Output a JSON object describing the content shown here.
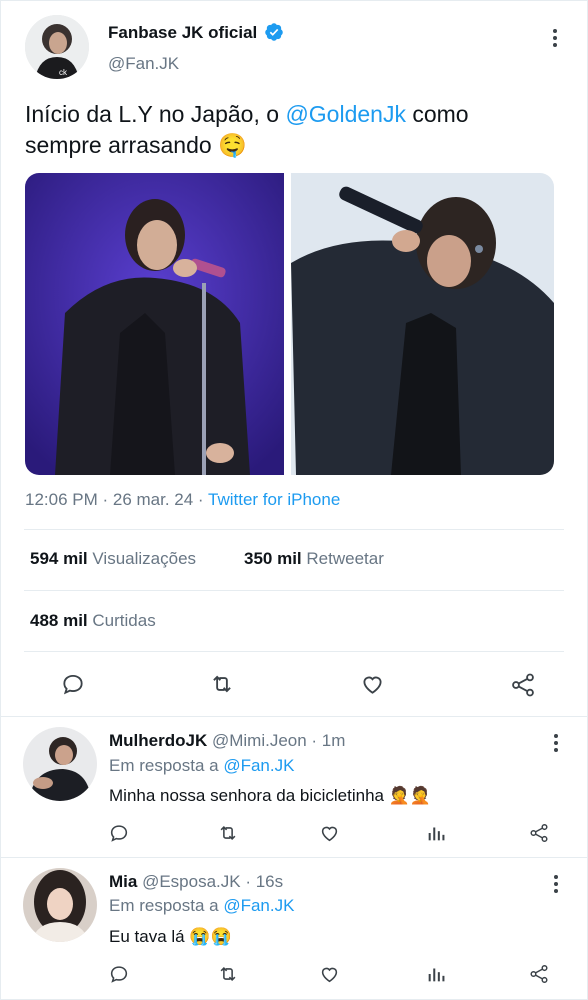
{
  "tweet": {
    "author_name": "Fanbase JK oficial",
    "handle": "@Fan.JK",
    "text_part1": "Início da L.Y no Japão, o ",
    "mention": "@GoldenJk",
    "text_part2": " como",
    "text_line2": "sempre arrasando",
    "emoji": "🤤",
    "time": "12:06 PM · 26 mar. 24 · ",
    "source": "Twitter for iPhone",
    "views_count": "594 mil",
    "views_label": "Visualizações",
    "retweets_count": "350 mil",
    "retweets_label": "Retweetar",
    "likes_count": "488 mil",
    "likes_label": "Curtidas"
  },
  "replies": [
    {
      "name": "MulherdoJK",
      "handle_time": "@Mimi.Jeon · 1m",
      "reply_prefix": "Em resposta a ",
      "reply_to": "@Fan.JK",
      "text": "Minha nossa senhora da bicicletinha ",
      "emoji": "🤦🤦"
    },
    {
      "name": "Mia",
      "handle_time": "@Esposa.JK · 16s",
      "reply_prefix": "Em resposta a ",
      "reply_to": "@Fan.JK",
      "text": "Eu tava lá ",
      "emoji": "😭😭"
    }
  ],
  "colors": {
    "accent": "#1d9bf0",
    "muted": "#687684",
    "verified": "#1d9bf0"
  },
  "icons": [
    "verified-badge-icon",
    "more-icon",
    "reply-icon",
    "retweet-icon",
    "like-icon",
    "share-icon",
    "views-icon"
  ]
}
